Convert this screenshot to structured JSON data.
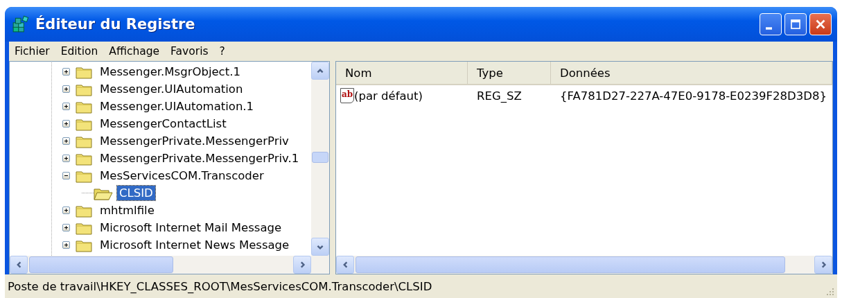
{
  "window": {
    "title": "Éditeur du Registre"
  },
  "menu": [
    {
      "label": "Fichier"
    },
    {
      "label": "Edition"
    },
    {
      "label": "Affichage"
    },
    {
      "label": "Favoris"
    },
    {
      "label": "?"
    }
  ],
  "tree": {
    "items": [
      {
        "label": "Messenger.MsgrObject.1",
        "expanded": false,
        "selected": false
      },
      {
        "label": "Messenger.UIAutomation",
        "expanded": false,
        "selected": false
      },
      {
        "label": "Messenger.UIAutomation.1",
        "expanded": false,
        "selected": false
      },
      {
        "label": "MessengerContactList",
        "expanded": false,
        "selected": false
      },
      {
        "label": "MessengerPrivate.MessengerPriv",
        "expanded": false,
        "selected": false
      },
      {
        "label": "MessengerPrivate.MessengerPriv.1",
        "expanded": false,
        "selected": false
      },
      {
        "label": "MesServicesCOM.Transcoder",
        "expanded": true,
        "selected": false,
        "children": [
          {
            "label": "CLSID",
            "selected": true
          }
        ]
      },
      {
        "label": "mhtmlfile",
        "expanded": false,
        "selected": false
      },
      {
        "label": "Microsoft Internet Mail Message",
        "expanded": false,
        "selected": false
      },
      {
        "label": "Microsoft Internet News Message",
        "expanded": false,
        "selected": false
      }
    ]
  },
  "values": {
    "columns": [
      "Nom",
      "Type",
      "Données"
    ],
    "rows": [
      {
        "icon_label": "ab",
        "name": "(par défaut)",
        "type": "REG_SZ",
        "data": "{FA781D27-227A-47E0-9178-E0239F28D3D8}"
      }
    ]
  },
  "status_bar": "Poste de travail\\HKEY_CLASSES_ROOT\\MesServicesCOM.Transcoder\\CLSID"
}
